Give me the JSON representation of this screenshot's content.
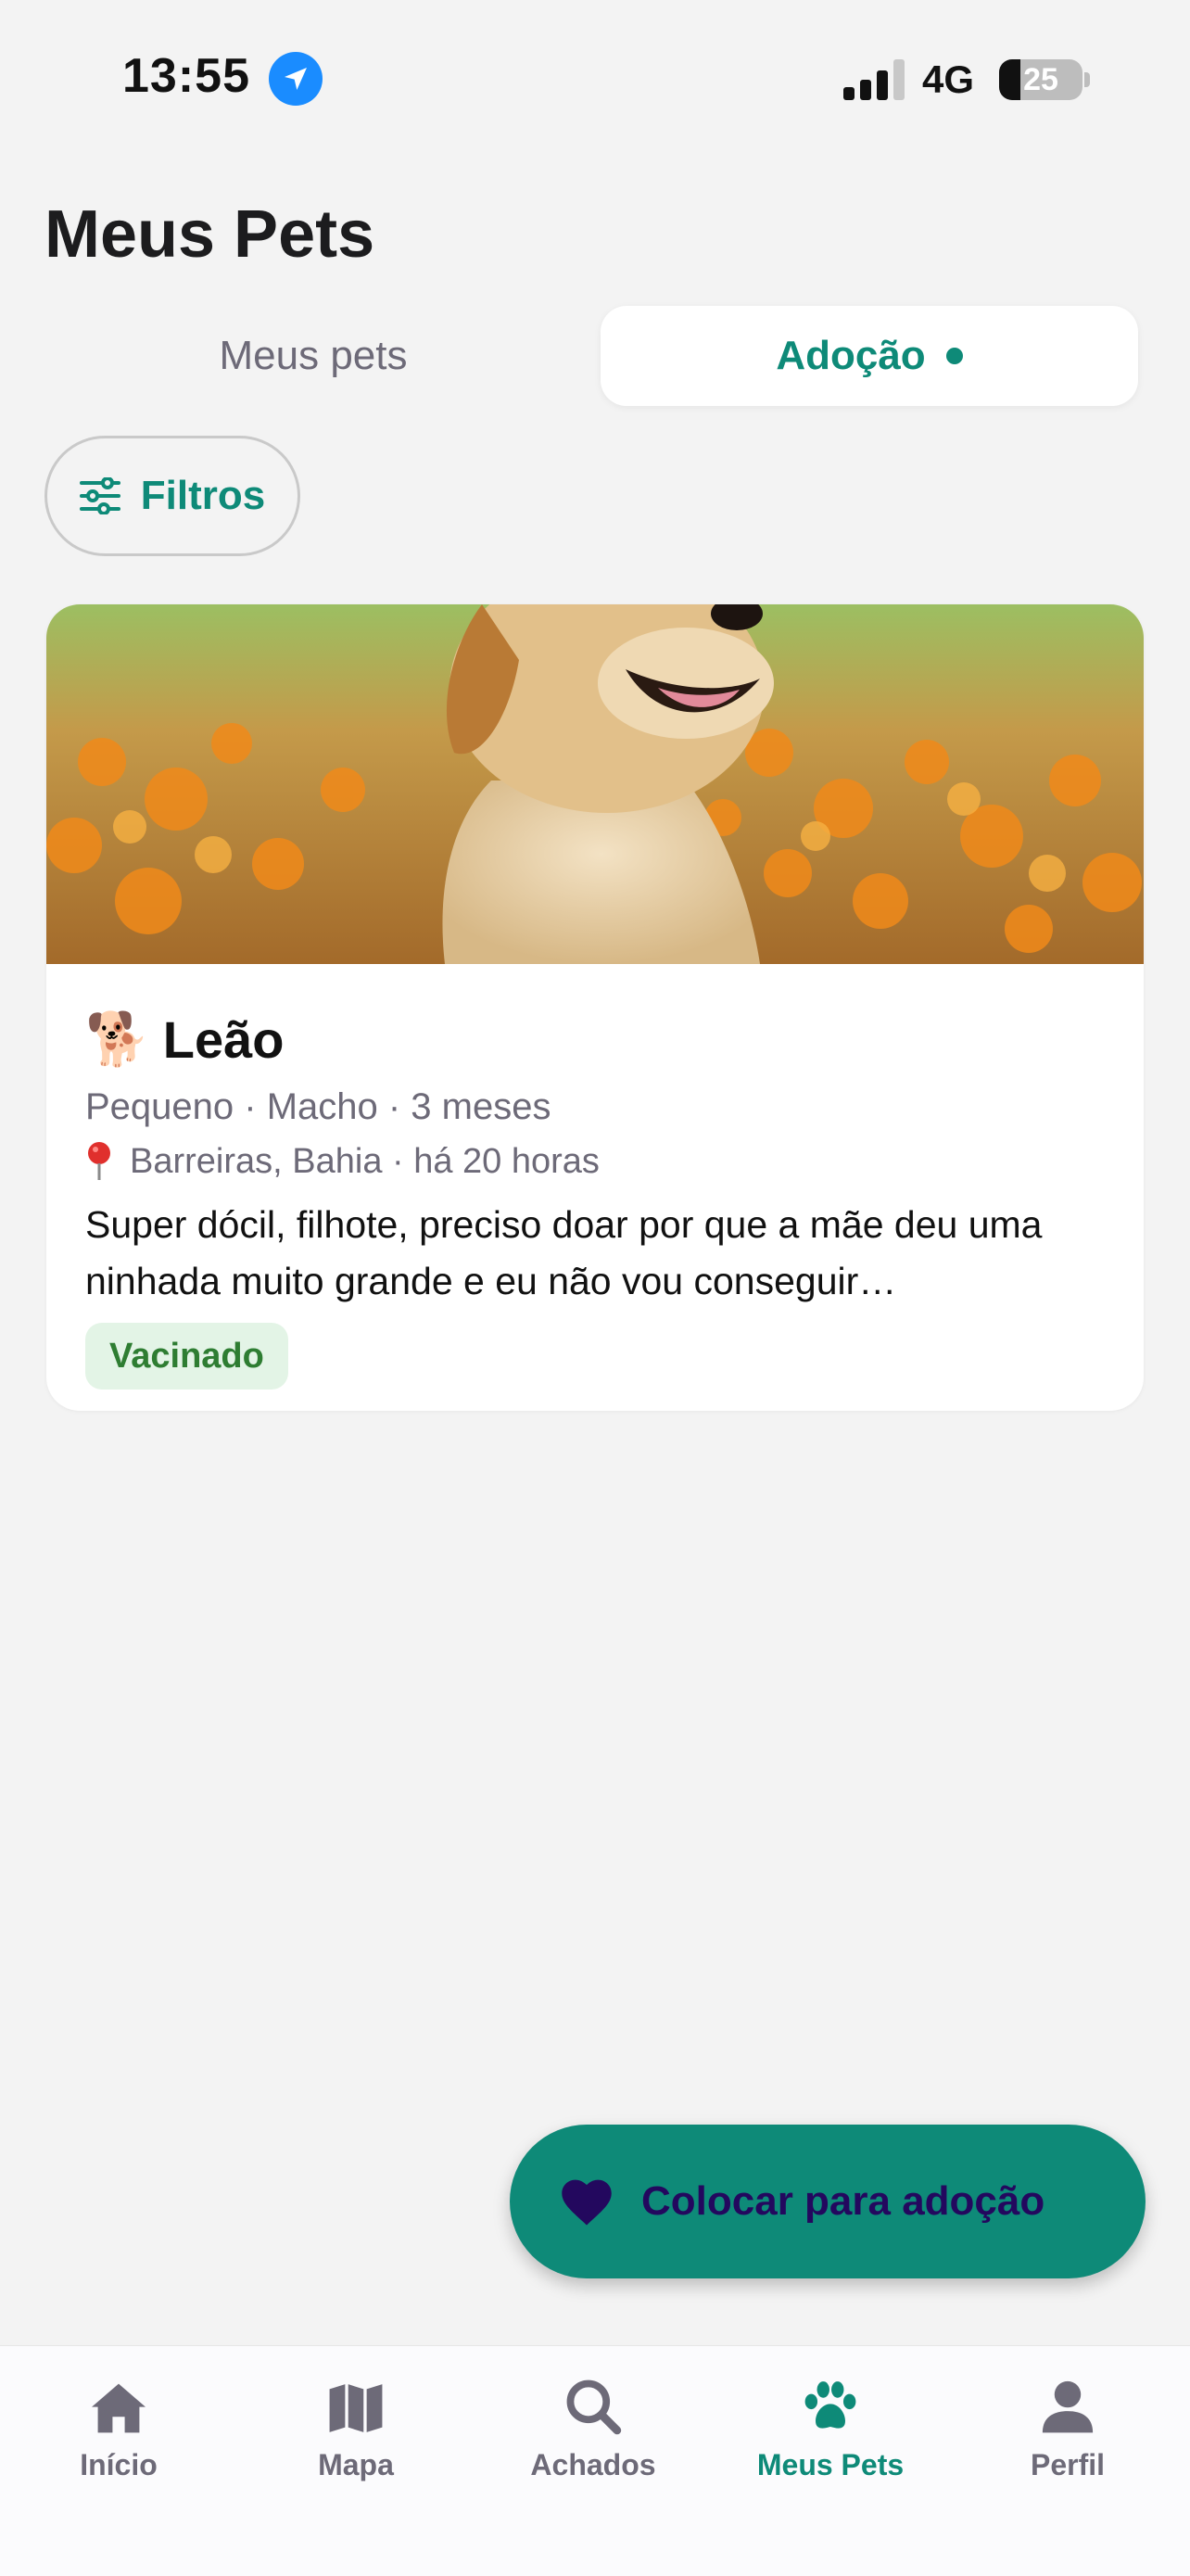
{
  "status_bar": {
    "time": "13:55",
    "network": "4G",
    "battery": "25",
    "battery_level": 0.25
  },
  "page": {
    "title": "Meus Pets"
  },
  "segments": {
    "tab1": "Meus pets",
    "tab2": "Adoção"
  },
  "filters": {
    "label": "Filtros"
  },
  "pet_card": {
    "emoji": "🐕",
    "name": "Leão",
    "meta": "Pequeno · Macho · 3 meses",
    "location": "Barreiras, Bahia · há 20 horas",
    "description": "Super dócil, filhote, preciso doar por que a mãe deu uma ninhada muito grande e eu não vou conseguir…",
    "badge": "Vacinado"
  },
  "fab": {
    "label": "Colocar para adoção"
  },
  "tabbar": {
    "items": [
      {
        "label": "Início",
        "icon": "home-icon"
      },
      {
        "label": "Mapa",
        "icon": "map-icon"
      },
      {
        "label": "Achados",
        "icon": "search-icon"
      },
      {
        "label": "Meus Pets",
        "icon": "paw-icon"
      },
      {
        "label": "Perfil",
        "icon": "person-icon"
      }
    ]
  },
  "colors": {
    "accent": "#0e8a78",
    "fab_text": "#23085e",
    "badge_bg": "#e3f4e6",
    "badge_text": "#2e7d32"
  }
}
